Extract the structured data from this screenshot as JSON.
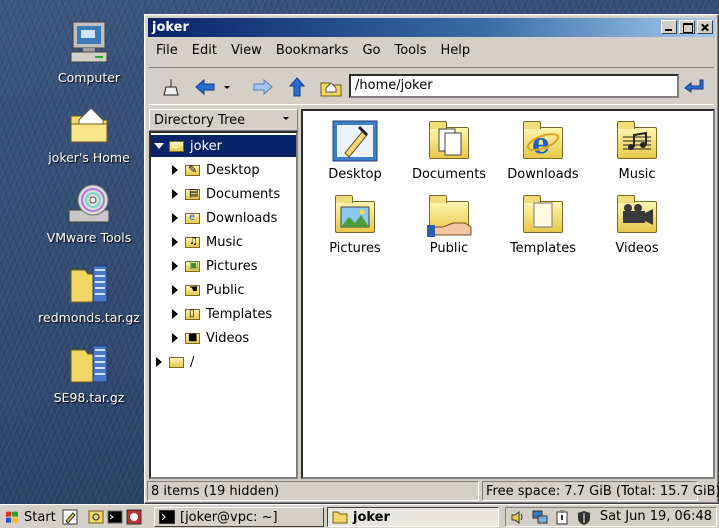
{
  "desktop": {
    "icons": [
      {
        "label": "Computer",
        "icon": "computer-icon"
      },
      {
        "label": "joker's Home",
        "icon": "home-folder-icon"
      },
      {
        "label": "VMware Tools",
        "icon": "cd-drive-icon"
      },
      {
        "label": "redmonds.tar.gz",
        "icon": "archive-icon"
      },
      {
        "label": "SE98.tar.gz",
        "icon": "archive-icon"
      }
    ]
  },
  "window": {
    "title": "joker",
    "menu": [
      "File",
      "Edit",
      "View",
      "Bookmarks",
      "Go",
      "Tools",
      "Help"
    ],
    "address": "/home/joker",
    "tree_header": "Directory Tree",
    "tree": [
      {
        "label": "joker",
        "icon": "home-icon",
        "expanded": true,
        "selected": true
      },
      {
        "label": "Desktop",
        "icon": "desktop-folder-icon"
      },
      {
        "label": "Documents",
        "icon": "documents-folder-icon"
      },
      {
        "label": "Downloads",
        "icon": "downloads-folder-icon"
      },
      {
        "label": "Music",
        "icon": "music-folder-icon"
      },
      {
        "label": "Pictures",
        "icon": "pictures-folder-icon"
      },
      {
        "label": "Public",
        "icon": "public-folder-icon"
      },
      {
        "label": "Templates",
        "icon": "templates-folder-icon"
      },
      {
        "label": "Videos",
        "icon": "videos-folder-icon"
      },
      {
        "label": "/",
        "icon": "root-folder-icon"
      }
    ],
    "files": [
      {
        "label": "Desktop",
        "icon": "desktop-folder-icon"
      },
      {
        "label": "Documents",
        "icon": "documents-folder-icon"
      },
      {
        "label": "Downloads",
        "icon": "downloads-folder-icon"
      },
      {
        "label": "Music",
        "icon": "music-folder-icon"
      },
      {
        "label": "Pictures",
        "icon": "pictures-folder-icon"
      },
      {
        "label": "Public",
        "icon": "public-folder-icon"
      },
      {
        "label": "Templates",
        "icon": "templates-folder-icon"
      },
      {
        "label": "Videos",
        "icon": "videos-folder-icon"
      }
    ],
    "status_left": "8 items (19 hidden)",
    "status_right": "Free space: 7.7 GiB (Total: 15.7 GiB)"
  },
  "taskbar": {
    "start_label": "Start",
    "tasks": [
      {
        "label": "[joker@vpc: ~]",
        "active": false
      },
      {
        "label": "joker",
        "active": true
      }
    ],
    "clock": "Sat Jun 19, 06:48"
  },
  "colors": {
    "title_active": "#0a246a",
    "face": "#d4d0c8",
    "selection": "#0a246a"
  }
}
